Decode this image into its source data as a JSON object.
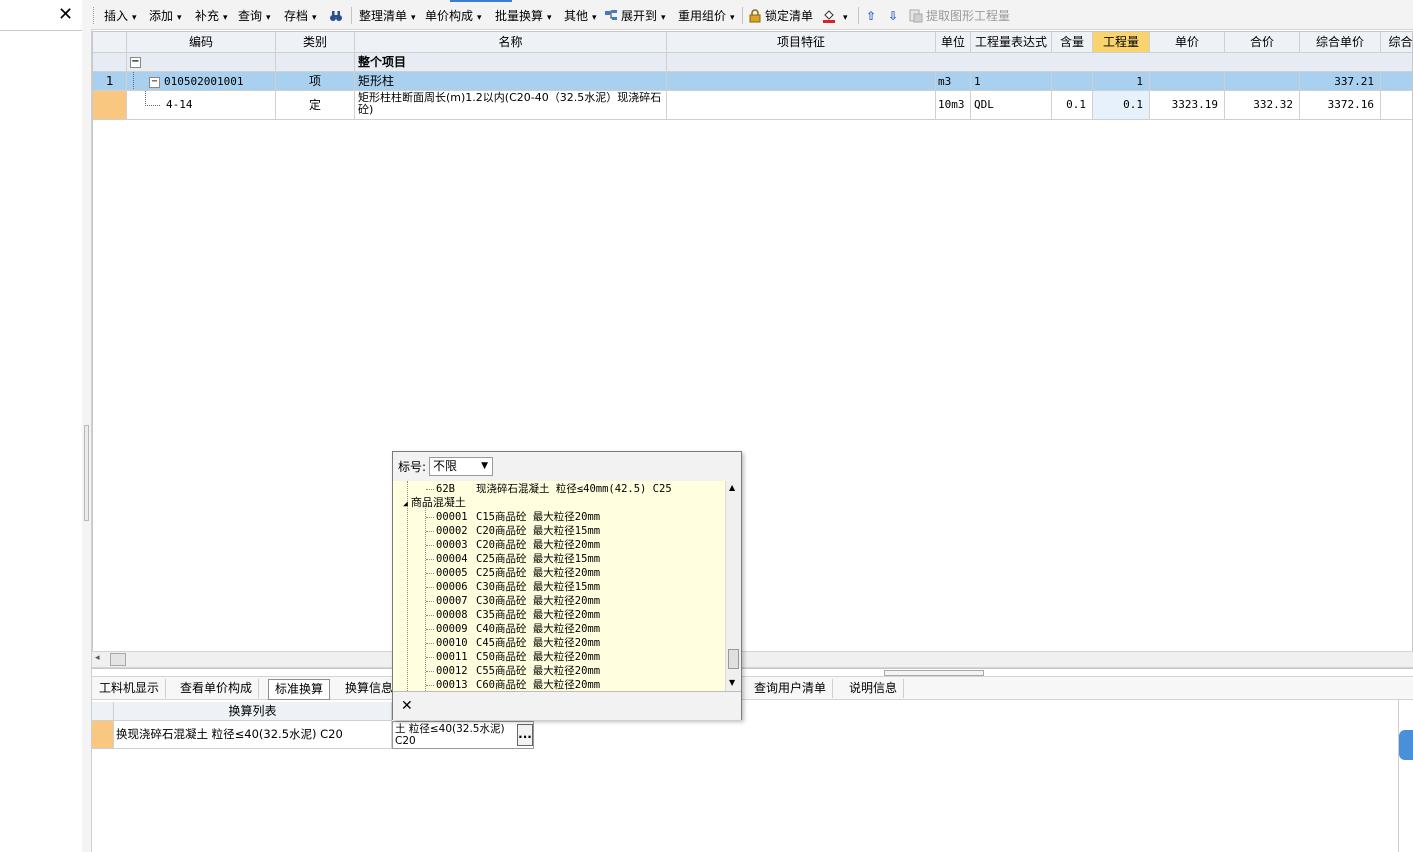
{
  "left_panel": {
    "close_label": "✕"
  },
  "toolbar": {
    "insert": "插入",
    "add": "添加",
    "supplement": "补充",
    "query": "查询",
    "archive": "存档",
    "organize_list": "整理清单",
    "unit_price_composition": "单价构成",
    "batch_conversion": "批量换算",
    "other": "其他",
    "expand_to": "展开到",
    "reuse_group_price": "重用组价",
    "lock_list": "锁定清单",
    "extract_quantity": "提取图形工程量"
  },
  "grid": {
    "headers": [
      "编码",
      "类别",
      "名称",
      "项目特征",
      "单位",
      "工程量表达式",
      "含量",
      "工程量",
      "单价",
      "合价",
      "综合单价",
      "综合"
    ],
    "top_row": {
      "tree": "−",
      "name": "整个项目"
    },
    "rows": [
      {
        "index": "1",
        "code": "010502001001",
        "type": "项",
        "name": "矩形柱",
        "feature": "",
        "unit": "m3",
        "expr": "1",
        "content": "",
        "quantity": "1",
        "unit_price": "",
        "total": "",
        "composite_unit_price": "337.21"
      },
      {
        "index": "",
        "code": "4-14",
        "type": "定",
        "name": "矩形柱柱断面周长(m)1.2以内(C20-40（32.5水泥）现浇碎石砼)",
        "feature": "",
        "unit": "10m3",
        "expr": "QDL",
        "content": "0.1",
        "quantity": "0.1",
        "unit_price": "3323.19",
        "total": "332.32",
        "composite_unit_price": "3372.16"
      }
    ]
  },
  "tabs": [
    {
      "label": "工料机显示",
      "active": false
    },
    {
      "label": "查看单价构成",
      "active": false
    },
    {
      "label": "标准换算",
      "active": true
    },
    {
      "label": "换算信息",
      "active": false
    },
    {
      "label": "查询用户清单",
      "active": false
    },
    {
      "label": "说明信息",
      "active": false
    }
  ],
  "bottom_grid": {
    "header": "换算列表",
    "row_text": "换现浇碎石混凝土 粒径≤40(32.5水泥) C20",
    "edit_value": "土 粒径≤40(32.5水泥) C20",
    "ellipsis": "..."
  },
  "popup": {
    "label": "标号:",
    "select_value": "不限",
    "top_item": {
      "code": "62B",
      "name": "现浇碎石混凝土 粒径≤40mm(42.5) C25"
    },
    "group": "商品混凝土",
    "items": [
      {
        "code": "00001",
        "name": "C15商品砼 最大粒径20mm"
      },
      {
        "code": "00002",
        "name": "C20商品砼 最大粒径15mm"
      },
      {
        "code": "00003",
        "name": "C20商品砼 最大粒径20mm"
      },
      {
        "code": "00004",
        "name": "C25商品砼 最大粒径15mm"
      },
      {
        "code": "00005",
        "name": "C25商品砼 最大粒径20mm"
      },
      {
        "code": "00006",
        "name": "C30商品砼 最大粒径15mm"
      },
      {
        "code": "00007",
        "name": "C30商品砼 最大粒径20mm"
      },
      {
        "code": "00008",
        "name": "C35商品砼 最大粒径20mm"
      },
      {
        "code": "00009",
        "name": "C40商品砼 最大粒径20mm"
      },
      {
        "code": "00010",
        "name": "C45商品砼 最大粒径20mm"
      },
      {
        "code": "00011",
        "name": "C50商品砼 最大粒径20mm"
      },
      {
        "code": "00012",
        "name": "C55商品砼 最大粒径20mm"
      },
      {
        "code": "00013",
        "name": "C60商品砼 最大粒径20mm"
      }
    ],
    "close_label": "✕"
  },
  "colors": {
    "selected_row": "#a9d1ef",
    "active_header": "#f9d36e",
    "row_marker": "#f9c77f",
    "popup_list_bg": "#ffffe0"
  }
}
